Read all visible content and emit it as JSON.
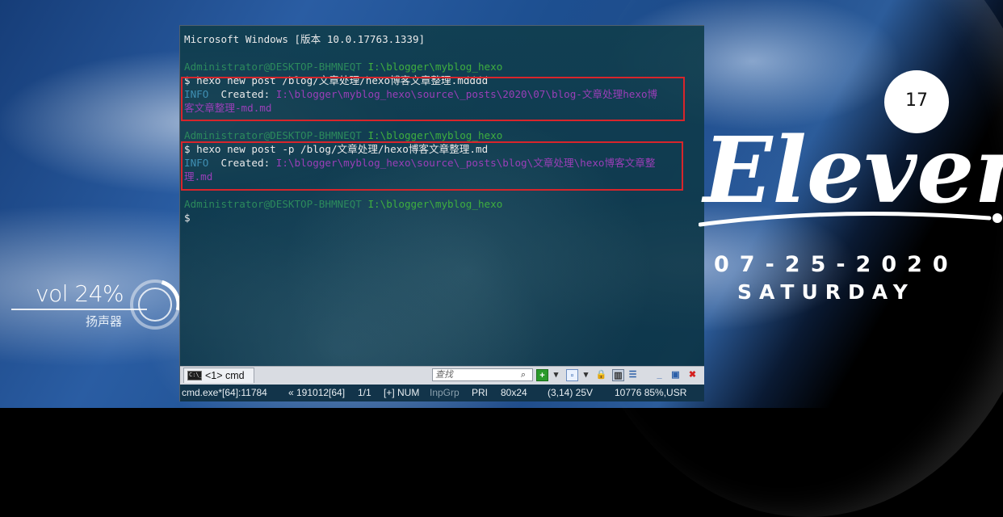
{
  "desktop": {
    "volume": {
      "text": "vol 24%",
      "device": "扬声器",
      "level": 0.24
    },
    "date_widget": {
      "day_badge": "17",
      "title": "Eleven",
      "date": "07-25-2020",
      "weekday": "SATURDAY"
    }
  },
  "terminal": {
    "lines": [
      {
        "segments": [
          {
            "text": "Microsoft Windows [版本 10.0.17763.1339]",
            "color": "white"
          }
        ]
      },
      {
        "segments": [
          {
            "text": "",
            "color": "white"
          }
        ]
      },
      {
        "segments": [
          {
            "text": "Administrator@DESKTOP-BHMNEQT ",
            "color": "grey"
          },
          {
            "text": "I:\\blogger\\myblog_hexo",
            "color": "green"
          }
        ]
      },
      {
        "segments": [
          {
            "text": "$ hexo new post /blog/文章处理/hexo博客文章整理.mdddd",
            "color": "white"
          }
        ]
      },
      {
        "segments": [
          {
            "text": "INFO  ",
            "color": "info"
          },
          {
            "text": "Created: ",
            "color": "white"
          },
          {
            "text": "I:\\blogger\\myblog_hexo\\source\\_posts\\2020\\07\\blog-文章处理hexo博",
            "color": "purple"
          }
        ]
      },
      {
        "segments": [
          {
            "text": "客文章整理-md.md",
            "color": "purple"
          }
        ]
      },
      {
        "segments": [
          {
            "text": "",
            "color": "white"
          }
        ]
      },
      {
        "segments": [
          {
            "text": "Administrator@DESKTOP-BHMNEQT ",
            "color": "grey"
          },
          {
            "text": "I:\\blogger\\myblog_hexo",
            "color": "green"
          }
        ]
      },
      {
        "segments": [
          {
            "text": "$ hexo new post -p /blog/文章处理/hexo博客文章整理.md",
            "color": "white"
          }
        ]
      },
      {
        "segments": [
          {
            "text": "INFO  ",
            "color": "info"
          },
          {
            "text": "Created: ",
            "color": "white"
          },
          {
            "text": "I:\\blogger\\myblog_hexo\\source\\_posts\\blog\\文章处理\\hexo博客文章整",
            "color": "purple"
          }
        ]
      },
      {
        "segments": [
          {
            "text": "理.md",
            "color": "purple"
          }
        ]
      },
      {
        "segments": [
          {
            "text": "",
            "color": "white"
          }
        ]
      },
      {
        "segments": [
          {
            "text": "Administrator@DESKTOP-BHMNEQT ",
            "color": "grey"
          },
          {
            "text": "I:\\blogger\\myblog_hexo",
            "color": "green"
          }
        ]
      },
      {
        "segments": [
          {
            "text": "$",
            "color": "white"
          }
        ]
      }
    ],
    "tab": {
      "label": "<1> cmd",
      "icon": "console-icon"
    },
    "search_placeholder": "查找",
    "status": {
      "process": "cmd.exe*[64]:11784",
      "build": "« 191012[64]",
      "pages": "1/1",
      "mode": "[+] NUM",
      "inp": "InpGrp",
      "pri": "PRI",
      "size": "80x24",
      "cursor": "(3,14) 25V",
      "mem": "10776 85%,USR"
    }
  },
  "colors": {
    "white": "#eaeaea",
    "grey": "#2c8a5c",
    "green": "#3fae3f",
    "info": "#3f8fb3",
    "purple": "#9a3fb8",
    "highlight": "#d8252b"
  }
}
